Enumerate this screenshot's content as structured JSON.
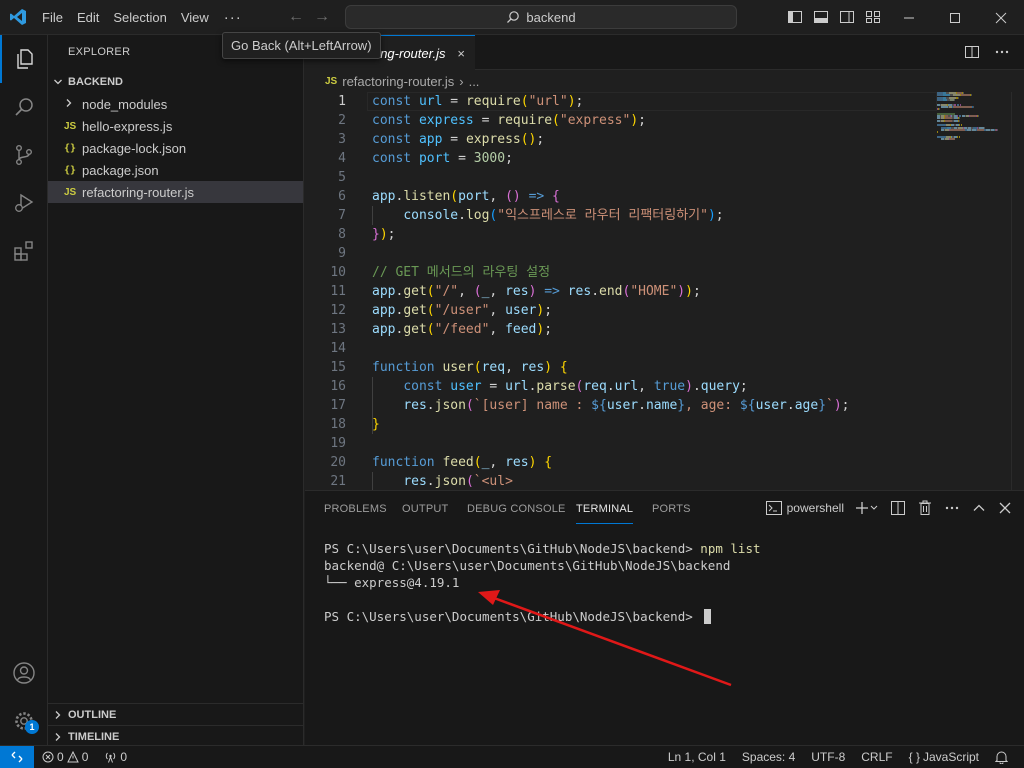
{
  "titlebar": {
    "menus": [
      "File",
      "Edit",
      "Selection",
      "View"
    ],
    "more": "···",
    "back_arrow": "←",
    "forward_arrow": "→",
    "search": "backend",
    "tooltip": "Go Back (Alt+LeftArrow)"
  },
  "sidebar": {
    "title": "EXPLORER",
    "folder": "BACKEND",
    "items": [
      {
        "label": "node_modules",
        "icon": "chevron-right-icon",
        "type": "folder"
      },
      {
        "label": "hello-express.js",
        "icon": "JS",
        "type": "js"
      },
      {
        "label": "package-lock.json",
        "icon": "{}",
        "type": "json"
      },
      {
        "label": "package.json",
        "icon": "{}",
        "type": "json"
      },
      {
        "label": "refactoring-router.js",
        "icon": "JS",
        "type": "js",
        "selected": true
      }
    ],
    "outline": "OUTLINE",
    "timeline": "TIMELINE",
    "accounts_badge": "1"
  },
  "tabs": [
    {
      "label": "refactoring-router.js",
      "icon": "JS",
      "close": "×"
    }
  ],
  "breadcrumb": {
    "icon": "JS",
    "file": "refactoring-router.js",
    "sep": "›",
    "more": "..."
  },
  "editor": {
    "lines": [
      {
        "n": "1",
        "cur": true,
        "tokens": [
          [
            "k",
            "const "
          ],
          [
            "c",
            "url"
          ],
          [
            "op",
            " = "
          ],
          [
            "f",
            "require"
          ],
          [
            "p1",
            "("
          ],
          [
            "s",
            "\"url\""
          ],
          [
            "p1",
            ")"
          ],
          [
            "op",
            ";"
          ]
        ]
      },
      {
        "n": "2",
        "tokens": [
          [
            "k",
            "const "
          ],
          [
            "c",
            "express"
          ],
          [
            "op",
            " = "
          ],
          [
            "f",
            "require"
          ],
          [
            "p1",
            "("
          ],
          [
            "s",
            "\"express\""
          ],
          [
            "p1",
            ")"
          ],
          [
            "op",
            ";"
          ]
        ]
      },
      {
        "n": "3",
        "tokens": [
          [
            "k",
            "const "
          ],
          [
            "c",
            "app"
          ],
          [
            "op",
            " = "
          ],
          [
            "f",
            "express"
          ],
          [
            "p1",
            "()"
          ],
          [
            "op",
            ";"
          ]
        ]
      },
      {
        "n": "4",
        "tokens": [
          [
            "k",
            "const "
          ],
          [
            "c",
            "port"
          ],
          [
            "op",
            " = "
          ],
          [
            "n",
            "3000"
          ],
          [
            "op",
            ";"
          ]
        ]
      },
      {
        "n": "5",
        "tokens": []
      },
      {
        "n": "6",
        "tokens": [
          [
            "v",
            "app"
          ],
          [
            "op",
            "."
          ],
          [
            "f",
            "listen"
          ],
          [
            "p1",
            "("
          ],
          [
            "v",
            "port"
          ],
          [
            "op",
            ", "
          ],
          [
            "p2",
            "()"
          ],
          [
            "op",
            " "
          ],
          [
            "k",
            "=>"
          ],
          [
            "op",
            " "
          ],
          [
            "p2",
            "{"
          ]
        ]
      },
      {
        "n": "7",
        "tokens": [
          [
            "op",
            "    "
          ],
          [
            "v",
            "console"
          ],
          [
            "op",
            "."
          ],
          [
            "f",
            "log"
          ],
          [
            "p3",
            "("
          ],
          [
            "s",
            "\"익스프레스로 라우터 리팩터링하기\""
          ],
          [
            "p3",
            ")"
          ],
          [
            "op",
            ";"
          ]
        ]
      },
      {
        "n": "8",
        "tokens": [
          [
            "p2",
            "}"
          ],
          [
            "p1",
            ")"
          ],
          [
            "op",
            ";"
          ]
        ]
      },
      {
        "n": "9",
        "tokens": []
      },
      {
        "n": "10",
        "tokens": [
          [
            "cm",
            "// GET 메서드의 라우팅 설정"
          ]
        ]
      },
      {
        "n": "11",
        "tokens": [
          [
            "v",
            "app"
          ],
          [
            "op",
            "."
          ],
          [
            "f",
            "get"
          ],
          [
            "p1",
            "("
          ],
          [
            "s",
            "\"/\""
          ],
          [
            "op",
            ", "
          ],
          [
            "p2",
            "("
          ],
          [
            "v",
            "_"
          ],
          [
            "op",
            ", "
          ],
          [
            "v",
            "res"
          ],
          [
            "p2",
            ")"
          ],
          [
            "op",
            " "
          ],
          [
            "k",
            "=>"
          ],
          [
            "op",
            " "
          ],
          [
            "v",
            "res"
          ],
          [
            "op",
            "."
          ],
          [
            "f",
            "end"
          ],
          [
            "p2",
            "("
          ],
          [
            "s",
            "\"HOME\""
          ],
          [
            "p2",
            ")"
          ],
          [
            "p1",
            ")"
          ],
          [
            "op",
            ";"
          ]
        ]
      },
      {
        "n": "12",
        "tokens": [
          [
            "v",
            "app"
          ],
          [
            "op",
            "."
          ],
          [
            "f",
            "get"
          ],
          [
            "p1",
            "("
          ],
          [
            "s",
            "\"/user\""
          ],
          [
            "op",
            ", "
          ],
          [
            "v",
            "user"
          ],
          [
            "p1",
            ")"
          ],
          [
            "op",
            ";"
          ]
        ]
      },
      {
        "n": "13",
        "tokens": [
          [
            "v",
            "app"
          ],
          [
            "op",
            "."
          ],
          [
            "f",
            "get"
          ],
          [
            "p1",
            "("
          ],
          [
            "s",
            "\"/feed\""
          ],
          [
            "op",
            ", "
          ],
          [
            "v",
            "feed"
          ],
          [
            "p1",
            ")"
          ],
          [
            "op",
            ";"
          ]
        ]
      },
      {
        "n": "14",
        "tokens": []
      },
      {
        "n": "15",
        "tokens": [
          [
            "k",
            "function "
          ],
          [
            "f",
            "user"
          ],
          [
            "p1",
            "("
          ],
          [
            "v",
            "req"
          ],
          [
            "op",
            ", "
          ],
          [
            "v",
            "res"
          ],
          [
            "p1",
            ")"
          ],
          [
            "op",
            " "
          ],
          [
            "p1",
            "{"
          ]
        ]
      },
      {
        "n": "16",
        "tokens": [
          [
            "op",
            "    "
          ],
          [
            "k",
            "const "
          ],
          [
            "c",
            "user"
          ],
          [
            "op",
            " = "
          ],
          [
            "v",
            "url"
          ],
          [
            "op",
            "."
          ],
          [
            "f",
            "parse"
          ],
          [
            "p2",
            "("
          ],
          [
            "v",
            "req"
          ],
          [
            "op",
            "."
          ],
          [
            "v",
            "url"
          ],
          [
            "op",
            ", "
          ],
          [
            "k",
            "true"
          ],
          [
            "p2",
            ")"
          ],
          [
            "op",
            "."
          ],
          [
            "v",
            "query"
          ],
          [
            "op",
            ";"
          ]
        ]
      },
      {
        "n": "17",
        "tokens": [
          [
            "op",
            "    "
          ],
          [
            "v",
            "res"
          ],
          [
            "op",
            "."
          ],
          [
            "f",
            "json"
          ],
          [
            "p2",
            "("
          ],
          [
            "s",
            "`[user] name : "
          ],
          [
            "k",
            "${"
          ],
          [
            "v",
            "user"
          ],
          [
            "op",
            "."
          ],
          [
            "v",
            "name"
          ],
          [
            "k",
            "}"
          ],
          [
            "s",
            ", age: "
          ],
          [
            "k",
            "${"
          ],
          [
            "v",
            "user"
          ],
          [
            "op",
            "."
          ],
          [
            "v",
            "age"
          ],
          [
            "k",
            "}"
          ],
          [
            "s",
            "`"
          ],
          [
            "p2",
            ")"
          ],
          [
            "op",
            ";"
          ]
        ]
      },
      {
        "n": "18",
        "tokens": [
          [
            "p1",
            "}"
          ]
        ]
      },
      {
        "n": "19",
        "tokens": []
      },
      {
        "n": "20",
        "tokens": [
          [
            "k",
            "function "
          ],
          [
            "f",
            "feed"
          ],
          [
            "p1",
            "("
          ],
          [
            "v",
            "_"
          ],
          [
            "op",
            ", "
          ],
          [
            "v",
            "res"
          ],
          [
            "p1",
            ")"
          ],
          [
            "op",
            " "
          ],
          [
            "p1",
            "{"
          ]
        ]
      },
      {
        "n": "21",
        "tokens": [
          [
            "op",
            "    "
          ],
          [
            "v",
            "res"
          ],
          [
            "op",
            "."
          ],
          [
            "f",
            "json"
          ],
          [
            "p2",
            "("
          ],
          [
            "s",
            "`<ul>"
          ]
        ]
      }
    ]
  },
  "panel": {
    "tabs": [
      "PROBLEMS",
      "OUTPUT",
      "DEBUG CONSOLE",
      "TERMINAL",
      "PORTS"
    ],
    "active_tab": "TERMINAL",
    "shell": "powershell",
    "terminal": {
      "prompt1": "PS C:\\Users\\user\\Documents\\GitHub\\NodeJS\\backend> ",
      "cmd1": "npm list",
      "out1": "backend@ C:\\Users\\user\\Documents\\GitHub\\NodeJS\\backend",
      "out2": "└── express@4.19.1",
      "prompt2": "PS C:\\Users\\user\\Documents\\GitHub\\NodeJS\\backend> "
    }
  },
  "statusbar": {
    "errors": "0",
    "warnings": "0",
    "ports": "0",
    "position": "Ln 1, Col 1",
    "spaces": "Spaces: 4",
    "encoding": "UTF-8",
    "eol": "CRLF",
    "lang_icon": "{ }",
    "language": "JavaScript"
  },
  "colors": {
    "accent": "#0078d4",
    "annotation_arrow": "#e01818",
    "js_icon": "#cbcb41"
  }
}
